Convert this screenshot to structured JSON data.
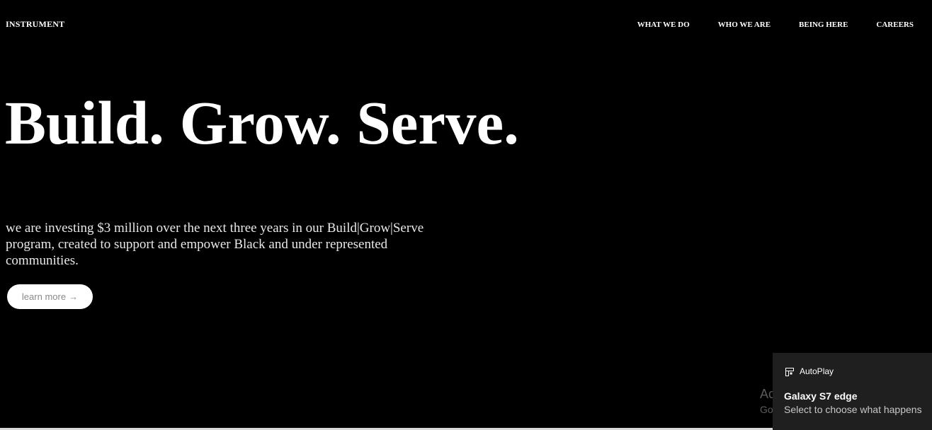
{
  "header": {
    "logo": "INSTRUMENT",
    "nav": [
      {
        "label": "WHAT WE DO"
      },
      {
        "label": "WHO WE ARE"
      },
      {
        "label": "BEING HERE"
      },
      {
        "label": "CAREERS"
      }
    ]
  },
  "hero": {
    "title": "Build. Grow. Serve.",
    "body": "we are investing $3 million over the next three years in our Build|Grow|Serve program, created to support and empower Black and under represented communities.",
    "button_label": "learn more",
    "button_arrow": "→"
  },
  "watermark": {
    "title": "Activate Windows",
    "subtitle": "Go to Settings to activate Windows."
  },
  "notification": {
    "app": "AutoPlay",
    "icon": "autoplay-icon",
    "title": "Galaxy S7 edge",
    "body": "Select to choose what happens"
  },
  "colors": {
    "background": "#000000",
    "text": "#ffffff",
    "button_bg": "#ffffff",
    "button_text": "#8a8a8a",
    "toast_bg": "#1f1f1f"
  }
}
